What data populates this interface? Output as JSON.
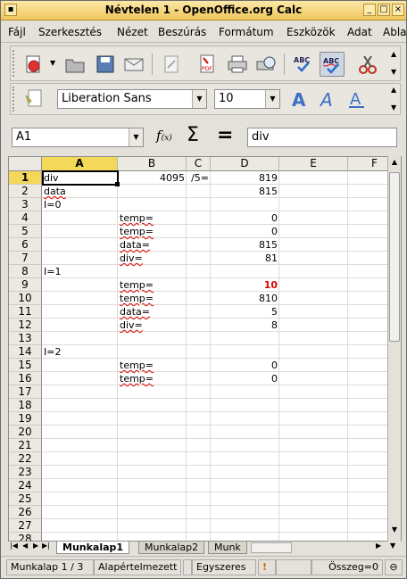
{
  "window": {
    "title": "Névtelen 1 - OpenOffice.org Calc"
  },
  "menu": [
    "Fájl",
    "Szerkesztés",
    "Nézet",
    "Beszúrás",
    "Formátum",
    "Eszközök",
    "Adat",
    "Abla"
  ],
  "font": {
    "name": "Liberation Sans",
    "size": "10"
  },
  "formula": {
    "cell_ref": "A1",
    "content": "div"
  },
  "columns": [
    "A",
    "B",
    "C",
    "D",
    "E",
    "F"
  ],
  "rows": [
    "1",
    "2",
    "3",
    "4",
    "5",
    "6",
    "7",
    "8",
    "9",
    "10",
    "11",
    "12",
    "13",
    "14",
    "15",
    "16",
    "17",
    "18",
    "19",
    "20",
    "21",
    "22",
    "23",
    "24",
    "25",
    "26",
    "27",
    "28"
  ],
  "cells": {
    "r1": {
      "a": "div",
      "b": "4095",
      "c": "/5=",
      "d": "819"
    },
    "r2": {
      "a": "data",
      "d": "815"
    },
    "r3": {
      "a": "I=0"
    },
    "r4": {
      "b": "temp=",
      "d": "0"
    },
    "r5": {
      "b": "temp=",
      "d": "0"
    },
    "r6": {
      "b": "data=",
      "d": "815"
    },
    "r7": {
      "b": "div=",
      "d": "81"
    },
    "r8": {
      "a": "I=1"
    },
    "r9": {
      "b": "temp=",
      "d": "10"
    },
    "r10": {
      "b": "temp=",
      "d": "810"
    },
    "r11": {
      "b": "data=",
      "d": "5"
    },
    "r12": {
      "b": "div=",
      "d": "8"
    },
    "r14": {
      "a": "I=2"
    },
    "r15": {
      "b": "temp=",
      "d": "0"
    },
    "r16": {
      "b": "temp=",
      "d": "0"
    }
  },
  "sheets": [
    "Munkalap1",
    "Munkalap2",
    "Munk"
  ],
  "status": {
    "sheet": "Munkalap 1 / 3",
    "style": "Alapértelmezett",
    "mode": "Egyszeres",
    "sum": "Összeg=0"
  },
  "colors": {
    "selected_header": "#f4d85a",
    "red_value": "#dd0000",
    "title_bar": "#f1c75c"
  }
}
